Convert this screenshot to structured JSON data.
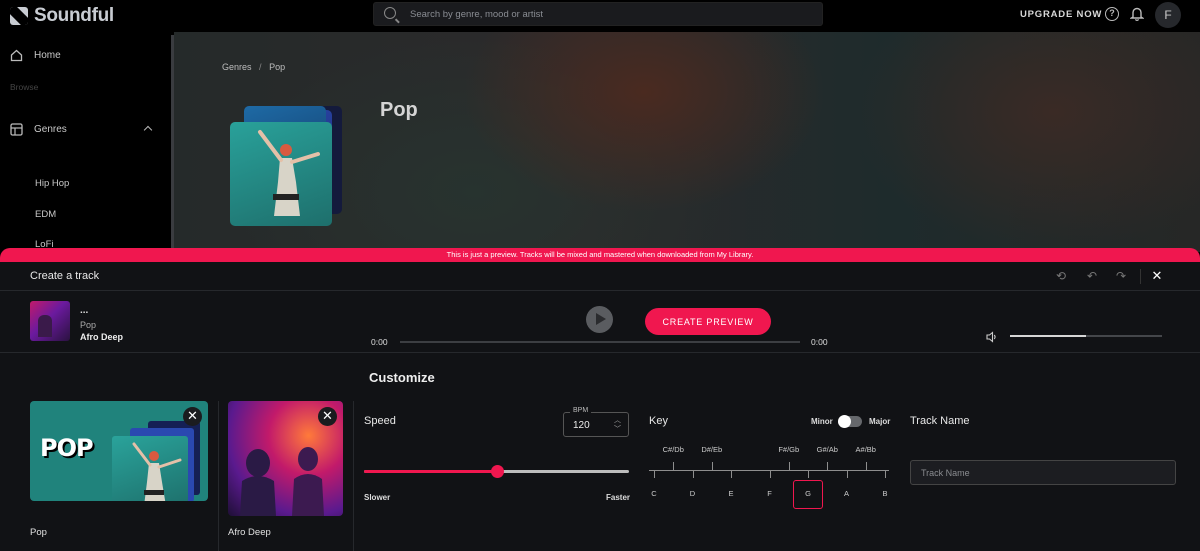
{
  "app": {
    "name": "Soundful"
  },
  "search": {
    "placeholder": "Search by genre, mood or artist"
  },
  "topbar": {
    "upgrade_label": "UPGRADE NOW",
    "help_glyph": "?",
    "avatar_initial": "F"
  },
  "sidebar": {
    "home": "Home",
    "browse": "Browse",
    "genres": "Genres",
    "sub_items": [
      "Hip Hop",
      "EDM",
      "LoFi"
    ]
  },
  "hero": {
    "breadcrumb": {
      "root": "Genres",
      "separator": "/",
      "current": "Pop"
    },
    "title": "Pop"
  },
  "banner": {
    "text": "This is just a preview. Tracks will be mixed and mastered when downloaded from My Library."
  },
  "panel": {
    "title": "Create a track",
    "icons": [
      "history-icon",
      "undo-icon",
      "redo-icon",
      "close-icon"
    ],
    "close_glyph": "✕",
    "undo_glyph": "↶",
    "redo_glyph": "↷",
    "history_glyph": "⟲"
  },
  "player": {
    "track_name": "...",
    "genre": "Pop",
    "template": "Afro Deep",
    "create_label": "CREATE PREVIEW",
    "time_start": "0:00",
    "time_end": "0:00",
    "volume": 0.5
  },
  "customize": {
    "title": "Customize",
    "cards": [
      {
        "label": "Pop",
        "cover_text": "POP"
      },
      {
        "label": "Afro Deep"
      }
    ],
    "close_glyph": "✕",
    "speed": {
      "label": "Speed",
      "bpm_tag": "BPM",
      "bpm_value": "120",
      "fraction": 0.5,
      "slower": "Slower",
      "faster": "Faster"
    },
    "key": {
      "label": "Key",
      "minor": "Minor",
      "major": "Major",
      "sharps": [
        "C#/Db",
        "D#/Eb",
        "F#/Gb",
        "G#/Ab",
        "A#/Bb"
      ],
      "naturals": [
        "C",
        "D",
        "E",
        "F",
        "G",
        "A",
        "B"
      ],
      "selected": "G"
    },
    "track_name": {
      "label": "Track Name",
      "placeholder": "Track Name"
    }
  },
  "colors": {
    "accent": "#f0174f",
    "panel": "#111215"
  }
}
